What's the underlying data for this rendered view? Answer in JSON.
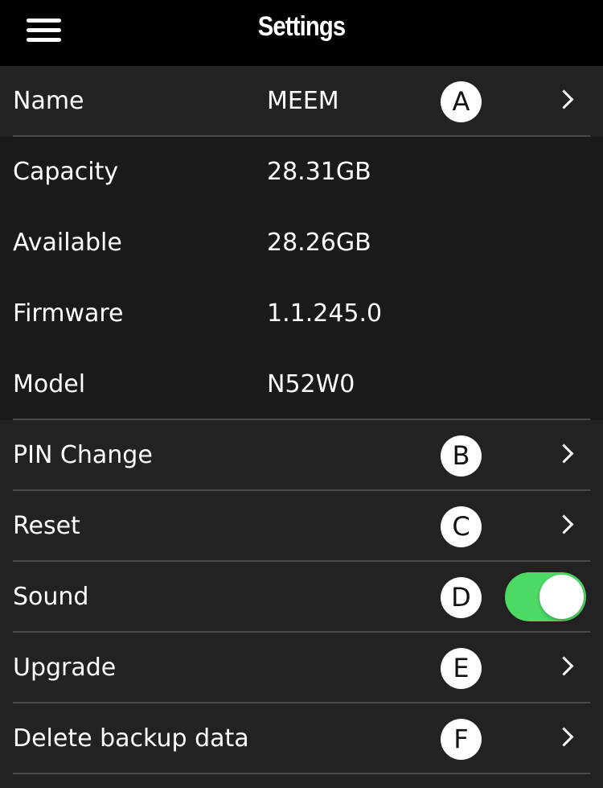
{
  "header": {
    "title": "Settings",
    "menu_icon": "hamburger-menu-icon"
  },
  "rows": {
    "name": {
      "label": "Name",
      "value": "MEEM",
      "badge": "A"
    },
    "capacity": {
      "label": "Capacity",
      "value": "28.31GB"
    },
    "available": {
      "label": "Available",
      "value": "28.26GB"
    },
    "firmware": {
      "label": "Firmware",
      "value": "1.1.245.0"
    },
    "model": {
      "label": "Model",
      "value": "N52W0"
    },
    "pin": {
      "label": "PIN Change",
      "badge": "B"
    },
    "reset": {
      "label": "Reset",
      "badge": "C"
    },
    "sound": {
      "label": "Sound",
      "badge": "D",
      "toggle_on": true
    },
    "upgrade": {
      "label": "Upgrade",
      "badge": "E"
    },
    "delete": {
      "label": "Delete backup data",
      "badge": "F"
    }
  },
  "colors": {
    "header_bg": "#000000",
    "row_bg": "#222222",
    "info_bg": "#1a1a1a",
    "toggle_on": "#4cd964",
    "separator": "#4a4a4a"
  }
}
